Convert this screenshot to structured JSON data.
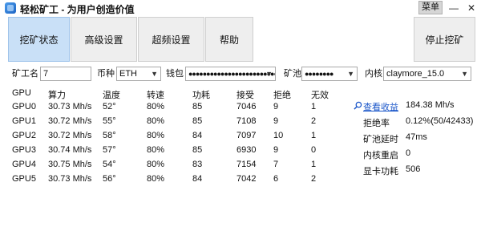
{
  "window": {
    "title": "轻松矿工 - 为用户创造价值",
    "menu_label": "菜单",
    "minimize": "—",
    "maximize": "☐",
    "close": "✕"
  },
  "nav": {
    "tabs": [
      "挖矿状态",
      "高级设置",
      "超频设置",
      "帮助"
    ],
    "active_index": 0,
    "stop_label": "停止挖矿"
  },
  "config": {
    "miner_name_label": "矿工名",
    "miner_name_value": "7",
    "coin_label": "币种",
    "coin_value": "ETH",
    "wallet_label": "钱包",
    "wallet_value": "●●●●●●●●●●●●●●●●●●●●●●●●●●",
    "pool_label": "矿池",
    "pool_value": "●●●●●●●●",
    "kernel_label": "内核",
    "kernel_value": "claymore_15.0"
  },
  "table": {
    "headers": [
      "GPU",
      "算力",
      "温度",
      "转速",
      "功耗",
      "接受",
      "拒绝",
      "无效"
    ],
    "rows": [
      [
        "GPU0",
        "30.73 Mh/s",
        "52°",
        "80%",
        "85",
        "7046",
        "9",
        "1"
      ],
      [
        "GPU1",
        "30.72 Mh/s",
        "55°",
        "80%",
        "85",
        "7108",
        "9",
        "2"
      ],
      [
        "GPU2",
        "30.72 Mh/s",
        "58°",
        "80%",
        "84",
        "7097",
        "10",
        "1"
      ],
      [
        "GPU3",
        "30.74 Mh/s",
        "57°",
        "80%",
        "85",
        "6930",
        "9",
        "0"
      ],
      [
        "GPU4",
        "30.75 Mh/s",
        "54°",
        "80%",
        "83",
        "7154",
        "7",
        "1"
      ],
      [
        "GPU5",
        "30.73 Mh/s",
        "56°",
        "80%",
        "84",
        "7042",
        "6",
        "2"
      ]
    ]
  },
  "stats": {
    "earnings_link": "查看收益",
    "hashrate": "184.38 Mh/s",
    "reject_rate_label": "拒绝率",
    "reject_rate": "0.12%(50/42433)",
    "pool_latency_label": "矿池延时",
    "pool_latency": "47ms",
    "kernel_restart_label": "内核重启",
    "kernel_restart": "0",
    "gpu_power_label": "显卡功耗",
    "gpu_power": "506"
  },
  "colors": {
    "active_tab_bg": "#c9e0f7",
    "link": "#1a56c9"
  }
}
